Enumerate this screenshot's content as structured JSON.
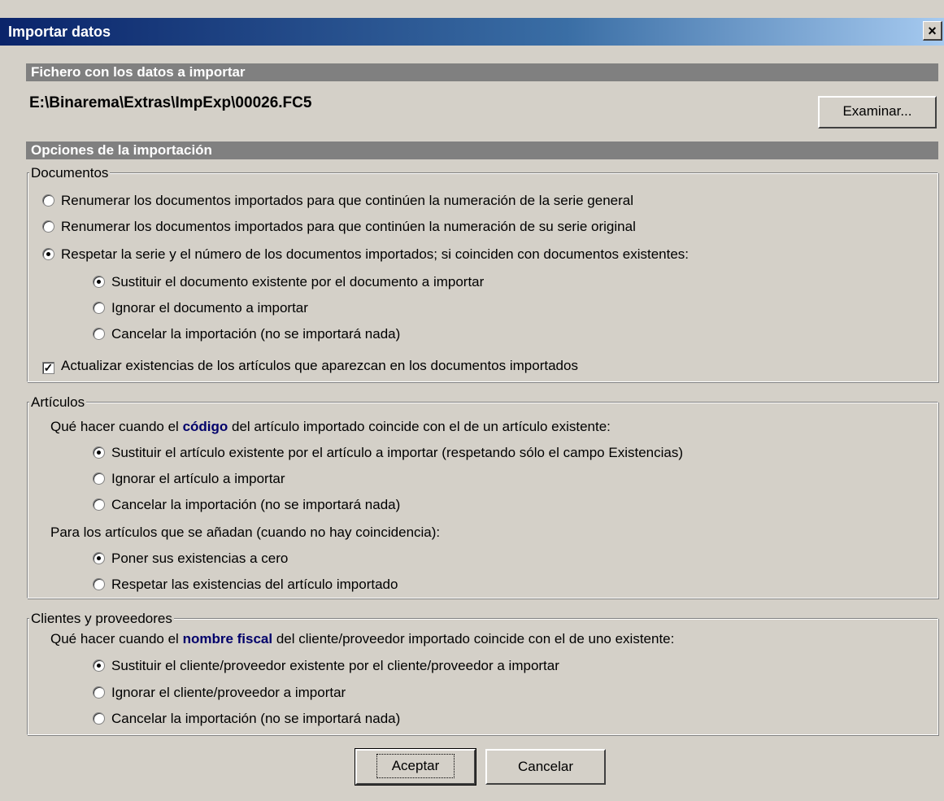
{
  "window": {
    "title": "Importar datos",
    "close_glyph": "×"
  },
  "file_section": {
    "header": "Fichero con los datos a importar",
    "path": "E:\\Binarema\\Extras\\ImpExp\\00026.FC5",
    "browse_label": "Examinar..."
  },
  "options_section": {
    "header": "Opciones de la importación"
  },
  "documentos": {
    "legend": "Documentos",
    "options": [
      {
        "label": "Renumerar los documentos importados para que continúen la numeración de la serie general",
        "selected": false
      },
      {
        "label": "Renumerar los documentos importados para que continúen la numeración de su serie original",
        "selected": false
      },
      {
        "label": "Respetar la serie y el número de los documentos importados; si coinciden con documentos existentes:",
        "selected": true
      }
    ],
    "sub_options": [
      {
        "label": "Sustituir el documento existente por el documento a importar",
        "selected": true
      },
      {
        "label": "Ignorar el documento a importar",
        "selected": false
      },
      {
        "label": "Cancelar la importación (no se importará nada)",
        "selected": false
      }
    ],
    "update_stock_label": "Actualizar existencias de los artículos que aparezcan en los documentos importados",
    "update_stock_checked": true
  },
  "articulos": {
    "legend": "Artículos",
    "question_prefix": "Qué hacer cuando el ",
    "question_bold": "código",
    "question_suffix": " del artículo importado coincide con el de un artículo existente:",
    "options": [
      {
        "label": "Sustituir el artículo existente por el artículo a importar (respetando sólo el campo Existencias)",
        "selected": true
      },
      {
        "label": "Ignorar el artículo a importar",
        "selected": false
      },
      {
        "label": "Cancelar la importación (no se importará nada)",
        "selected": false
      }
    ],
    "new_items_label": "Para los artículos que se añadan (cuando no hay coincidencia):",
    "new_items_options": [
      {
        "label": "Poner sus existencias a cero",
        "selected": true
      },
      {
        "label": "Respetar las existencias del artículo importado",
        "selected": false
      }
    ]
  },
  "clientes": {
    "legend": "Clientes y proveedores",
    "question_prefix": "Qué hacer cuando el ",
    "question_bold": "nombre fiscal",
    "question_suffix": " del cliente/proveedor importado coincide con el de uno existente:",
    "options": [
      {
        "label": "Sustituir el cliente/proveedor existente por el cliente/proveedor a importar",
        "selected": true
      },
      {
        "label": "Ignorar el cliente/proveedor a importar",
        "selected": false
      },
      {
        "label": "Cancelar la importación (no se importará nada)",
        "selected": false
      }
    ]
  },
  "buttons": {
    "accept": "Aceptar",
    "cancel": "Cancelar"
  }
}
